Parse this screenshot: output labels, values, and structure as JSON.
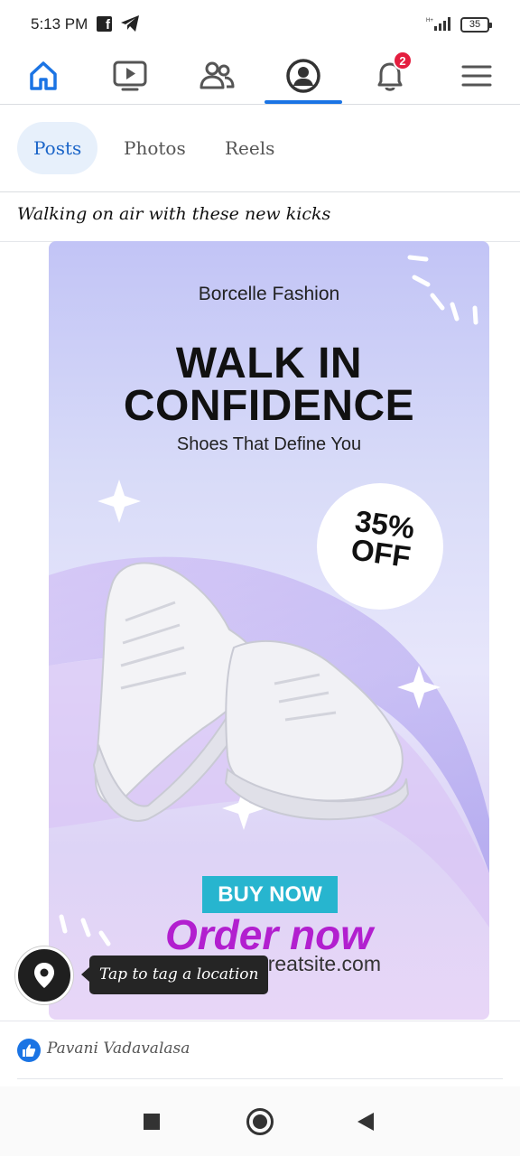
{
  "status_bar": {
    "time": "5:13 PM",
    "battery": "35",
    "network": "H+"
  },
  "top_nav": {
    "items": [
      "home",
      "watch",
      "friends",
      "profile",
      "notifications",
      "menu"
    ],
    "active": "profile",
    "notification_count": "2",
    "accent": "#1b74e4"
  },
  "tabs": [
    {
      "label": "Posts",
      "active": true
    },
    {
      "label": "Photos",
      "active": false
    },
    {
      "label": "Reels",
      "active": false
    }
  ],
  "post": {
    "caption": "Walking on air with these new kicks",
    "ad": {
      "brand": "Borcelle Fashion",
      "headline_line1": "WALK IN",
      "headline_line2": "CONFIDENCE",
      "tagline": "Shoes That Define You",
      "offer_line1": "35%",
      "offer_line2": "OFF",
      "buy_label": "BUY NOW",
      "overlay_text": "Order now",
      "url": "www.reallygreatsite.com"
    },
    "location_tooltip": "Tap to tag a location",
    "reaction_name": "Pavani Vadavalasa"
  }
}
